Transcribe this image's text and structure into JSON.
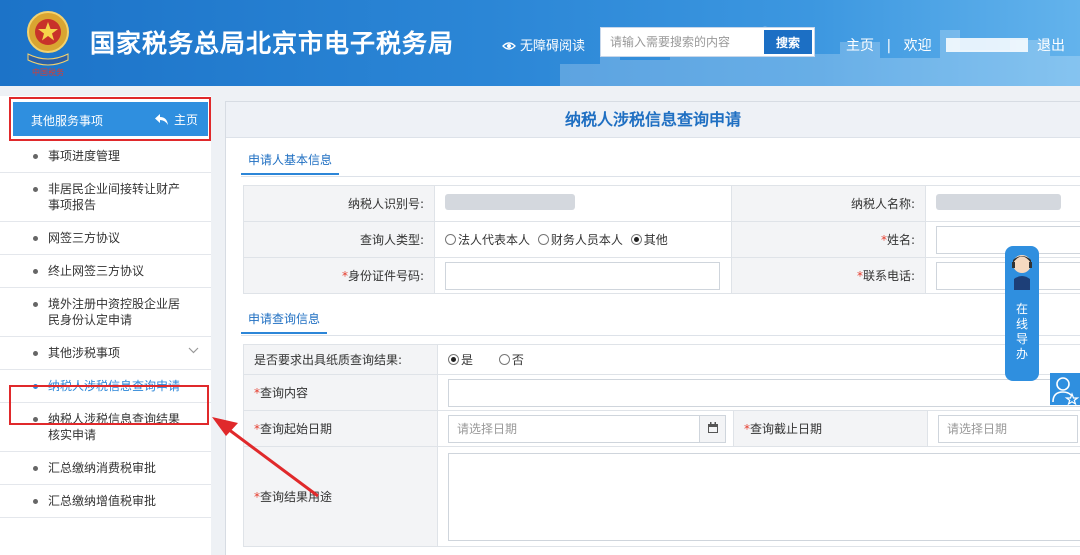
{
  "header": {
    "site_title": "国家税务总局北京市电子税务局",
    "emblem_text": "中国税务",
    "accessibility_label": "无障碍阅读",
    "search_placeholder": "请输入需要搜索的内容",
    "search_button": "搜索",
    "home_link": "主页",
    "separator": "|",
    "welcome": "欢迎",
    "user_quote": "\"",
    "logout": "退出"
  },
  "sidebar": {
    "header_label": "其他服务事项",
    "home_label": "主页",
    "items": [
      {
        "label": "事项进度管理"
      },
      {
        "label": "非居民企业间接转让财产事项报告"
      },
      {
        "label": "网签三方协议"
      },
      {
        "label": "终止网签三方协议"
      },
      {
        "label": "境外注册中资控股企业居民身份认定申请"
      },
      {
        "label": "其他涉税事项"
      },
      {
        "label": "纳税人涉税信息查询申请"
      },
      {
        "label": "纳税人涉税信息查询结果核实申请"
      },
      {
        "label": "汇总缴纳消费税审批"
      },
      {
        "label": "汇总缴纳增值税审批"
      }
    ],
    "active_index": 6
  },
  "main": {
    "title": "纳税人涉税信息查询申请",
    "section1": {
      "tab": "申请人基本信息",
      "taxpayer_id_label": "纳税人识别号:",
      "taxpayer_name_label": "纳税人名称:",
      "requester_type_label": "查询人类型:",
      "requester_options": [
        "法人代表本人",
        "财务人员本人",
        "其他"
      ],
      "requester_selected": "其他",
      "name_label": "姓名:",
      "id_number_label": "身份证件号码:",
      "phone_label": "联系电话:",
      "required_mark": "*"
    },
    "section2": {
      "tab": "申请查询信息",
      "paper_result_label": "是否要求出具纸质查询结果:",
      "paper_options": [
        "是",
        "否"
      ],
      "paper_selected": "是",
      "query_content_label": "查询内容",
      "start_date_label": "查询起始日期",
      "start_date_placeholder": "请选择日期",
      "end_date_label": "查询截止日期",
      "end_date_placeholder": "请选择日期",
      "purpose_label": "查询结果用途"
    }
  },
  "floating": {
    "guide_text": [
      "在",
      "线",
      "导",
      "办"
    ]
  },
  "colors": {
    "header_blue": "#1c73c8",
    "accent_blue": "#2c86d8",
    "title_blue": "#1f6fc2",
    "required_red": "#e53b2c",
    "highlight_red": "#e0292b"
  }
}
